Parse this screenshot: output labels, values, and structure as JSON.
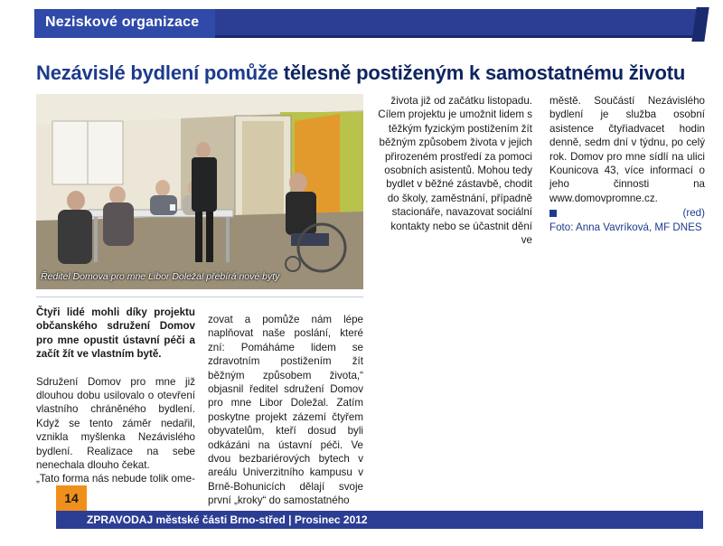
{
  "section": {
    "title": "Neziskové organizace"
  },
  "headline": {
    "part1": "Nezávislé bydlení pomůže",
    "part2": "tělesně postiženým k samostatnému životu"
  },
  "photo": {
    "caption": "Ředitel Domova pro mne Libor Doležal přebírá nové byty"
  },
  "columns": {
    "a": {
      "lead": "Čtyři lidé mohli díky projektu občanského sdružení Domov pro mne opustit ústavní péči a začít žít ve vlastním bytě.",
      "body": "Sdružení Domov pro mne již dlouhou dobu usilovalo o otevření vlastního chráněného bydlení. Když se tento záměr nedařil, vznikla myšlenka Nezávislého bydlení. Realizace na sebe nenechala dlouho čekat.",
      "quote": "„Tato forma nás nebude tolik ome-"
    },
    "b": {
      "body": "zovat a pomůže nám lépe naplňovat naše poslání, které zní: Pomáháme lidem se zdravotním postižením žít běžným způsobem života,“ objasnil ředitel sdružení Domov pro mne Libor Doležal. Zatím poskytne projekt zázemí čtyřem obyvatelům, kteří dosud byli odkázáni na ústavní péči. Ve dvou bezbariérových bytech v areálu Univerzitního kampusu v Brně-Bohunicích dělají svoje první „kroky“ do samostatného"
    },
    "c": {
      "body": "života již od začátku listopadu. Cílem projektu je umožnit lidem s těžkým fyzickým postižením žít běžným způsobem života v jejich přirozeném prostředí za pomoci osobních asistentů. Mohou tedy bydlet v běžné zástavbě, chodit do školy, zaměstnání, případně stacionáře, navazovat sociální kontakty nebo se účastnit dění ve"
    },
    "d": {
      "body": "městě. Součástí Nezávislého bydlení je služba osobní asistence čtyřiadvacet hodin denně, sedm dní v týdnu, po celý rok. Domov pro mne sídlí na ulici Kounicova 43, více informací o jeho činnosti na www.domovpromne.cz.",
      "author": "(red)",
      "photo_credit": "Foto: Anna Vavríková, MF DNES"
    }
  },
  "footer": {
    "page_number": "14",
    "text": "ZPRAVODAJ městské části Brno-střed | Prosinec 2012"
  },
  "colors": {
    "brand_blue": "#2c3e94",
    "headline_blue": "#1d3b8c",
    "page_number_orange": "#f0901c"
  },
  "icons": [
    "end-of-article-square-icon"
  ]
}
